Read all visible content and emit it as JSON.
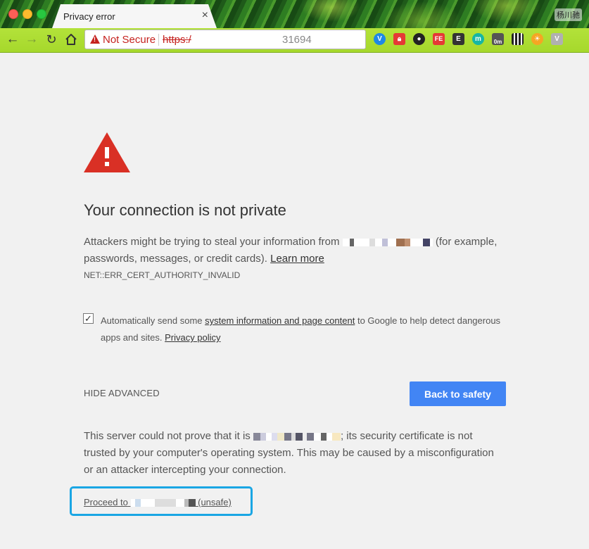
{
  "window": {
    "tab_title": "Privacy error",
    "tab_close": "×",
    "profile_name": "杨川驰"
  },
  "toolbar": {
    "back_icon": "arrow-left",
    "forward_icon": "arrow-right",
    "reload_icon": "reload",
    "home_icon": "home",
    "security_label": "Not Secure",
    "url_scheme": "https:/",
    "url_port": "31694",
    "extensions": [
      "v-extension",
      "lock-extension",
      "record-extension",
      "fe-extension",
      "evernote-extension",
      "m-extension",
      "0m-extension",
      "qr-code-extension",
      "sun-extension",
      "vue-extension"
    ],
    "extension_badge": "0m"
  },
  "page": {
    "heading": "Your connection is not private",
    "intro_before": "Attackers might be trying to steal your information from",
    "intro_after": "(for example, passwords, messages, or credit cards).",
    "learn_more": "Learn more",
    "error_code": "NET::ERR_CERT_AUTHORITY_INVALID",
    "checkbox_checked": true,
    "checkbox_text_before": "Automatically send some",
    "checkbox_link": "system information and page content",
    "checkbox_text_after": "to Google to help detect dangerous apps and sites.",
    "privacy_policy": "Privacy policy",
    "hide_advanced": "HIDE ADVANCED",
    "back_to_safety": "Back to safety",
    "server_before": "This server could not prove that it is",
    "server_after": "; its security certificate is not trusted by your computer's operating system. This may be caused by a misconfiguration or an attacker intercepting your connection.",
    "proceed_before": "Proceed to",
    "proceed_after": "(unsafe)"
  },
  "colors": {
    "accent_blue": "#4285f4",
    "warning_red": "#c5221f",
    "highlight_box": "#1aa6e4",
    "toolbar_green": "#a6d82c"
  }
}
